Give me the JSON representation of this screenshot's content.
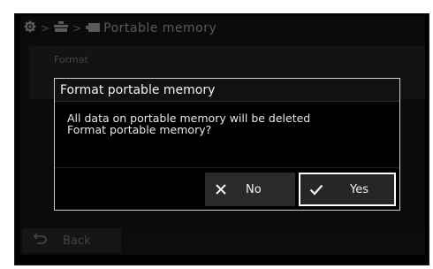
{
  "header": {
    "icons": [
      "gear-icon",
      "storage-icon",
      "memory-card-icon"
    ],
    "title": "Portable memory"
  },
  "background_menu": {
    "items": [
      {
        "label": "Format"
      },
      {
        "label": ""
      }
    ]
  },
  "footer": {
    "back_label": "Back"
  },
  "dialog": {
    "title": "Format portable memory",
    "message_line1": "All data on portable memory will be deleted",
    "message_line2": "Format portable memory?",
    "buttons": {
      "no_label": "No",
      "yes_label": "Yes"
    }
  },
  "colors": {
    "dialog_border": "#cfcfcf",
    "selected_border": "#ffffff",
    "button_bg": "#2a2a2a"
  }
}
